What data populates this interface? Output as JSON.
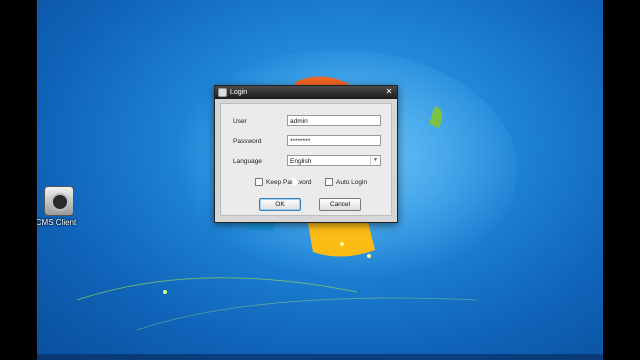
{
  "desktop": {
    "icon_label": "CMS Client"
  },
  "dialog": {
    "title": "Login",
    "close_symbol": "✕",
    "fields": {
      "user_label": "User",
      "user_value": "admin",
      "password_label": "Password",
      "password_value": "********",
      "language_label": "Language",
      "language_value": "English"
    },
    "checkboxes": {
      "keep_password": "Keep Password",
      "auto_login": "Auto Login"
    },
    "buttons": {
      "ok": "OK",
      "cancel": "Cancel"
    }
  }
}
